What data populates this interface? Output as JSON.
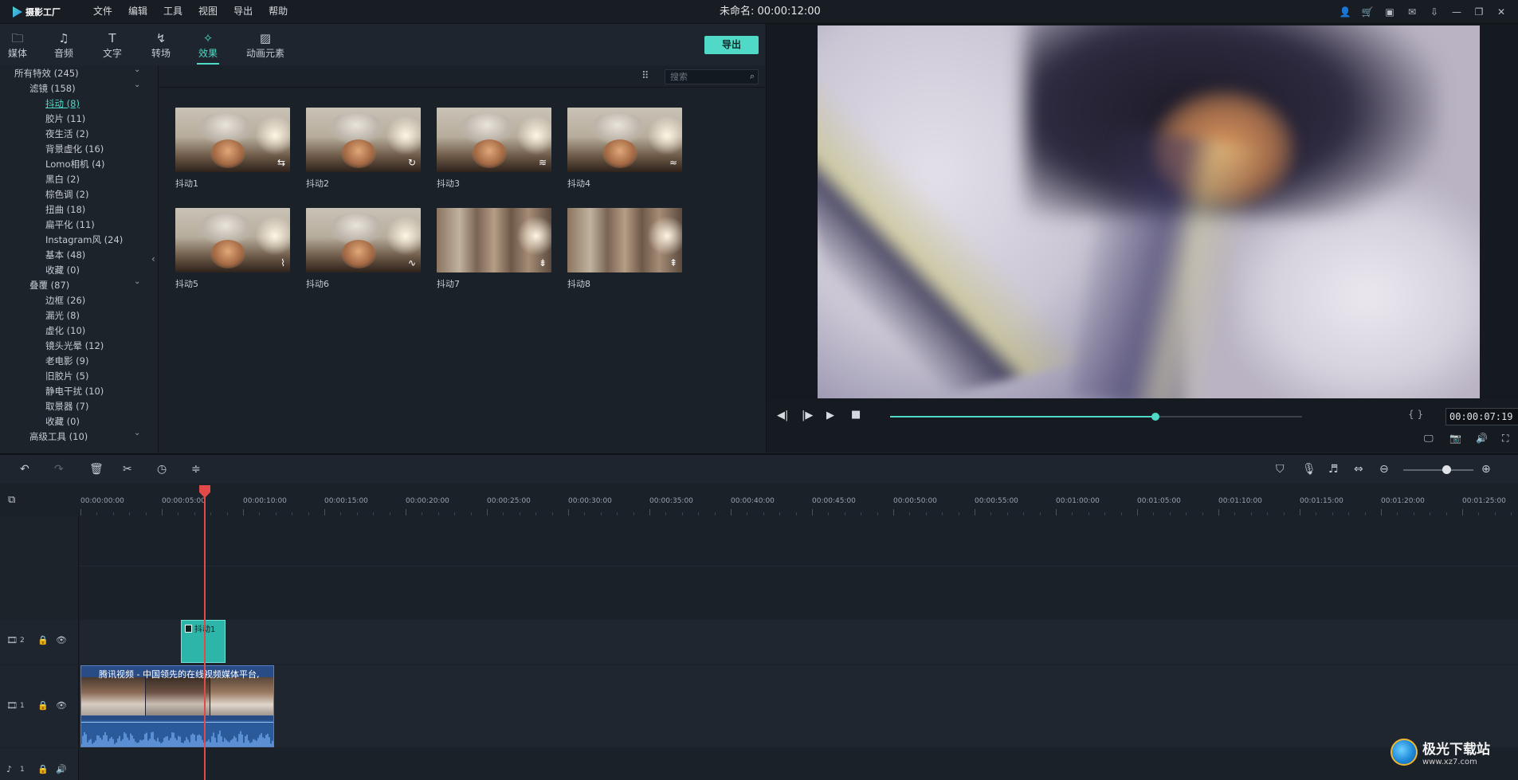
{
  "app": {
    "logo_text": "摄影工厂",
    "menu": [
      "文件",
      "编辑",
      "工具",
      "视图",
      "导出",
      "帮助"
    ],
    "project_title": "未命名: 00:00:12:00",
    "window_icons": [
      "user-icon",
      "cart-icon",
      "save-icon",
      "mail-icon",
      "download-icon",
      "minimize-icon",
      "restore-icon",
      "close-icon"
    ]
  },
  "tabs": [
    {
      "label": "媒体",
      "icon": "folder-icon"
    },
    {
      "label": "音频",
      "icon": "music-icon"
    },
    {
      "label": "文字",
      "icon": "text-icon"
    },
    {
      "label": "转场",
      "icon": "transition-icon"
    },
    {
      "label": "效果",
      "icon": "effect-icon",
      "active": true
    },
    {
      "label": "动画元素",
      "icon": "image-icon"
    }
  ],
  "export_label": "导出",
  "sidebar": {
    "items": [
      {
        "label": "所有特效 (245)",
        "level": 0
      },
      {
        "label": "滤镜 (158)",
        "level": 1
      },
      {
        "label": "抖动 (8)",
        "level": 2,
        "selected": true
      },
      {
        "label": "胶片 (11)",
        "level": 2
      },
      {
        "label": "夜生活 (2)",
        "level": 2
      },
      {
        "label": "背景虚化 (16)",
        "level": 2
      },
      {
        "label": "Lomo相机 (4)",
        "level": 2
      },
      {
        "label": "黑白 (2)",
        "level": 2
      },
      {
        "label": "棕色调 (2)",
        "level": 2
      },
      {
        "label": "扭曲 (18)",
        "level": 2
      },
      {
        "label": "扁平化 (11)",
        "level": 2
      },
      {
        "label": "Instagram风 (24)",
        "level": 2
      },
      {
        "label": "基本 (48)",
        "level": 2
      },
      {
        "label": "收藏 (0)",
        "level": 2
      },
      {
        "label": "叠覆 (87)",
        "level": 1
      },
      {
        "label": "边框 (26)",
        "level": 2
      },
      {
        "label": "漏光 (8)",
        "level": 2
      },
      {
        "label": "虚化 (10)",
        "level": 2
      },
      {
        "label": "镜头光晕 (12)",
        "level": 2
      },
      {
        "label": "老电影 (9)",
        "level": 2
      },
      {
        "label": "旧胶片 (5)",
        "level": 2
      },
      {
        "label": "静电干扰 (10)",
        "level": 2
      },
      {
        "label": "取景器 (7)",
        "level": 2
      },
      {
        "label": "收藏 (0)",
        "level": 2
      },
      {
        "label": "高级工具 (10)",
        "level": 1
      }
    ]
  },
  "search": {
    "placeholder": "搜索",
    "value": ""
  },
  "effects": [
    {
      "label": "抖动1",
      "badge": "⇆"
    },
    {
      "label": "抖动2",
      "badge": "↻"
    },
    {
      "label": "抖动3",
      "badge": "≋"
    },
    {
      "label": "抖动4",
      "badge": "≈"
    },
    {
      "label": "抖动5",
      "badge": "⌇"
    },
    {
      "label": "抖动6",
      "badge": "∿"
    },
    {
      "label": "抖动7",
      "badge": "⇟"
    },
    {
      "label": "抖动8",
      "badge": "⇞"
    }
  ],
  "player": {
    "progress": 0.645,
    "timecode": "00:00:07:19",
    "bracket_label": "{ }"
  },
  "ruler_labels": [
    "00:00:00:00",
    "00:00:05:00",
    "00:00:10:00",
    "00:00:15:00",
    "00:00:20:00",
    "00:00:25:00",
    "00:00:30:00",
    "00:00:35:00",
    "00:00:40:00",
    "00:00:45:00",
    "00:00:50:00",
    "00:00:55:00",
    "00:01:00:00",
    "00:01:05:00",
    "00:01:10:00",
    "00:01:15:00",
    "00:01:20:00",
    "00:01:25:00"
  ],
  "timeline": {
    "tracks": [
      {
        "label": "2",
        "type": "video"
      },
      {
        "label": "1",
        "type": "video"
      },
      {
        "label": "1",
        "type": "audio"
      }
    ],
    "effect_clip_label": "抖动1",
    "video_clip_label": "腾讯视频 - 中国领先的在线视频媒体平台,",
    "zoom_level": 0.56
  },
  "watermark": {
    "title": "极光下载站",
    "url": "www.xz7.com"
  },
  "colors": {
    "accent": "#4fd9c6",
    "playhead": "#e24a4a",
    "video_clip": "#2a4c86",
    "effect_clip": "#2eb5a9"
  }
}
